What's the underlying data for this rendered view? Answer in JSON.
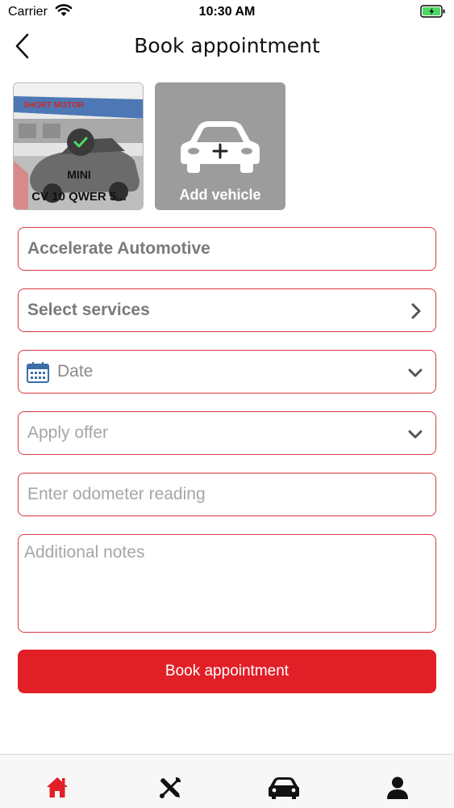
{
  "status_bar": {
    "carrier": "Carrier",
    "time": "10:30 AM"
  },
  "header": {
    "title": "Book appointment",
    "back_icon": "chevron-left-icon"
  },
  "vehicles": [
    {
      "make": "MINI",
      "registration": "CV 10 QWER 5...",
      "selected": true,
      "photo_sign_text": "SHORT MOTOR"
    },
    {
      "label": "Add vehicle",
      "icon": "car-plus-icon"
    }
  ],
  "form": {
    "garage": "Accelerate Automotive",
    "services": "Select services",
    "date_placeholder": "Date",
    "offer_placeholder": "Apply offer",
    "odometer_placeholder": "Enter odometer reading",
    "notes_placeholder": "Additional notes"
  },
  "book_button": "Book appointment",
  "tab_bar": {
    "items": [
      {
        "name": "home",
        "icon": "home-icon",
        "active": true
      },
      {
        "name": "services",
        "icon": "tools-icon",
        "active": false
      },
      {
        "name": "vehicles",
        "icon": "car-icon",
        "active": false
      },
      {
        "name": "profile",
        "icon": "user-icon",
        "active": false
      }
    ]
  },
  "colors": {
    "accent": "#e11f27",
    "field_border": "#d8383f",
    "card_grey": "#9c9c9c",
    "battery": "#4cd964"
  }
}
